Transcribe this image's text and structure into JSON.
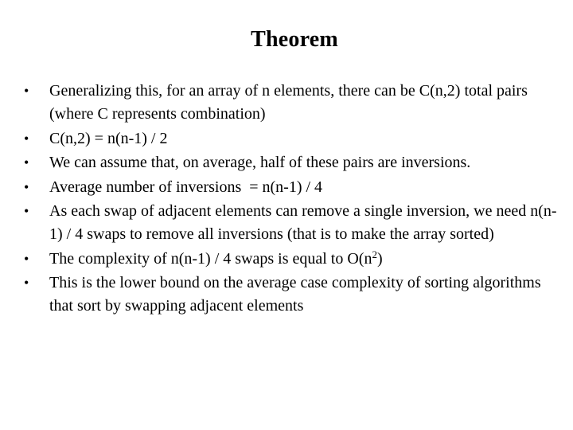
{
  "slide": {
    "title": "Theorem",
    "bullet_marker": "•",
    "bullets": [
      {
        "text": "Generalizing this, for an array of n elements, there can be C(n,2) total pairs (where C represents combination)"
      },
      {
        "text": "C(n,2) = n(n-1) / 2"
      },
      {
        "text": "We can assume that, on average, half of these pairs are inversions."
      },
      {
        "text": "Average number of inversions  = n(n-1) / 4"
      },
      {
        "text": "As each swap of adjacent elements can remove a single inversion, we need n(n-1) / 4 swaps to remove all inversions (that is to make the array sorted)"
      },
      {
        "text_before": "The complexity of n(n-1) / 4 swaps is equal to O(n",
        "superscript": "2",
        "text_after": ")"
      },
      {
        "text": "This is the lower bound on the average case complexity of sorting algorithms that sort by swapping adjacent elements"
      }
    ]
  }
}
